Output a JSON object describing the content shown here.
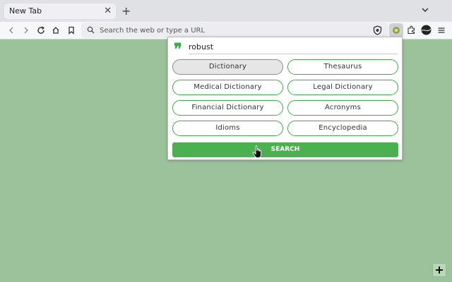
{
  "tab": {
    "title": "New Tab"
  },
  "urlbar": {
    "placeholder": "Search the web or type a URL"
  },
  "popup": {
    "query": "robust",
    "options": [
      {
        "label": "Dictionary",
        "selected": true
      },
      {
        "label": "Thesaurus",
        "selected": false
      },
      {
        "label": "Medical Dictionary",
        "selected": false
      },
      {
        "label": "Legal Dictionary",
        "selected": false
      },
      {
        "label": "Financial Dictionary",
        "selected": false
      },
      {
        "label": "Acronyms",
        "selected": false
      },
      {
        "label": "Idioms",
        "selected": false
      },
      {
        "label": "Encyclopedia",
        "selected": false
      }
    ],
    "search_label": "SEARCH"
  },
  "colors": {
    "page_background": "#9cc29b",
    "accent_green": "#4caf50"
  },
  "icons": [
    "back-icon",
    "forward-icon",
    "reload-icon",
    "home-icon",
    "bookmark-icon",
    "search-icon",
    "shield-icon",
    "extension-icon",
    "puzzle-icon",
    "profile-icon",
    "menu-icon",
    "quote-icon",
    "plus-icon"
  ]
}
